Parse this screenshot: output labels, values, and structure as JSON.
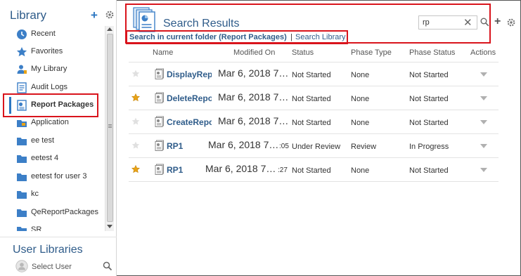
{
  "sidebar": {
    "title": "Library",
    "items": [
      {
        "label": "Recent",
        "icon": "clock-icon"
      },
      {
        "label": "Favorites",
        "icon": "star-icon"
      },
      {
        "label": "My Library",
        "icon": "user-icon"
      },
      {
        "label": "Audit Logs",
        "icon": "audit-icon"
      },
      {
        "label": "Report Packages",
        "icon": "report-package-icon"
      },
      {
        "label": "Application",
        "icon": "application-icon"
      },
      {
        "label": "ee test",
        "icon": "folder-icon"
      },
      {
        "label": "eetest 4",
        "icon": "folder-icon"
      },
      {
        "label": "eetest for user 3",
        "icon": "folder-icon"
      },
      {
        "label": "kc",
        "icon": "folder-icon"
      },
      {
        "label": "QeReportPackages",
        "icon": "folder-icon"
      },
      {
        "label": "SR",
        "icon": "folder-icon"
      }
    ],
    "selected_index": 4,
    "user_libraries_title": "User Libraries",
    "select_user_label": "Select User"
  },
  "main": {
    "title": "Search Results",
    "search_value": "rp",
    "link_current_folder": "Search in current folder (Report Packages)",
    "link_separator": "|",
    "link_search_library": "Search Library",
    "columns": [
      "Name",
      "Modified On",
      "Status",
      "Phase Type",
      "Phase Status",
      "Actions"
    ],
    "rows": [
      {
        "favorite": false,
        "name": "DisplayRepo",
        "modified": "Mar 6, 2018 7…",
        "modified_tail": "",
        "status": "Not Started",
        "phase_type": "None",
        "phase_status": "Not Started"
      },
      {
        "favorite": true,
        "name": "DeleteRepo",
        "modified": "Mar 6, 2018 7…",
        "modified_tail": "",
        "status": "Not Started",
        "phase_type": "None",
        "phase_status": "Not Started"
      },
      {
        "favorite": false,
        "name": "CreateRepo",
        "modified": "Mar 6, 2018 7…",
        "modified_tail": "",
        "status": "Not Started",
        "phase_type": "None",
        "phase_status": "Not Started"
      },
      {
        "favorite": false,
        "name": "RP1",
        "modified": "Mar 6, 2018 7…",
        "modified_tail": ":05",
        "status": "Under Review",
        "phase_type": "Review",
        "phase_status": "In Progress"
      },
      {
        "favorite": true,
        "name": "RP1",
        "modified": "Mar 6, 2018 7…",
        "modified_tail": ":27",
        "status": "Not Started",
        "phase_type": "None",
        "phase_status": "Not Started"
      }
    ]
  },
  "colors": {
    "title_blue": "#2f5c8a",
    "accent_blue": "#2c77c2",
    "highlight_red": "#d9141c",
    "star_gold": "#e8a317"
  }
}
